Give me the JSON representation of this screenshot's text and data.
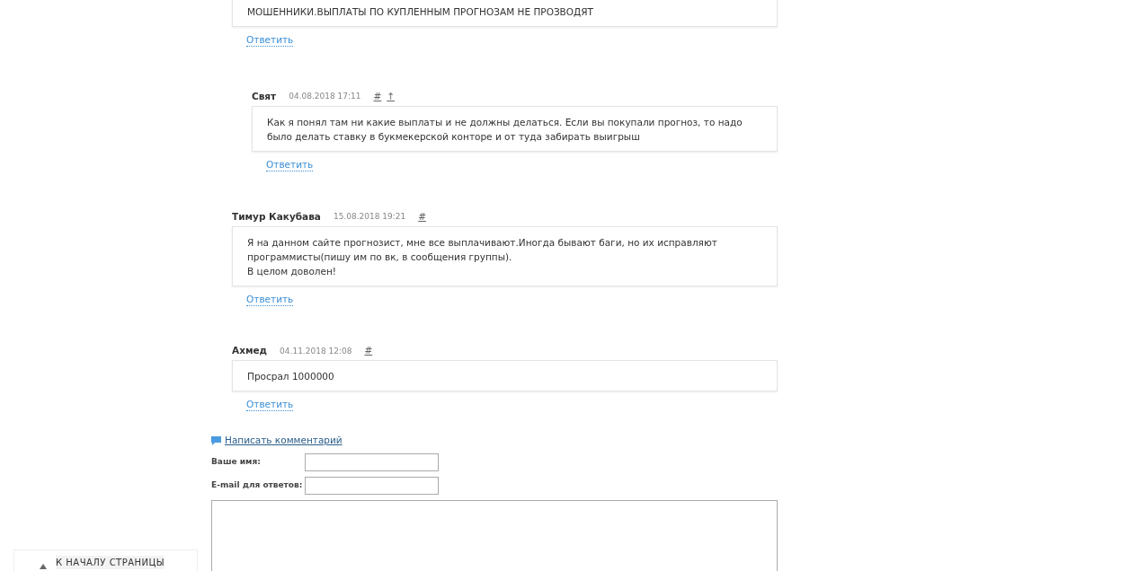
{
  "comments": [
    {
      "lines": [
        "МОШЕННИКИ.ВЫПЛАТЫ ПО КУПЛЕННЫМ ПРОГНОЗАМ НЕ ПРОЗВОДЯТ"
      ],
      "reply": "Ответить",
      "children": [
        {
          "author": "Свят",
          "date": "04.08.2018 17:11",
          "hash": "#",
          "up": "↑",
          "lines": [
            "Как я понял там ни какие выплаты и не должны делаться. Если вы покупали прогноз, то надо было делать ставку в букмекерской конторе и от туда забирать выигрыш"
          ],
          "reply": "Ответить"
        }
      ]
    },
    {
      "author": "Тимур Какубава",
      "date": "15.08.2018 19:21",
      "hash": "#",
      "lines": [
        "Я на данном сайте прогнозист, мне все выплачивают.Иногда бывают баги, но их исправляют программисты(пишу им по вк, в сообщения группы).",
        "В целом доволен!"
      ],
      "reply": "Ответить"
    },
    {
      "author": "Ахмед",
      "date": "04.11.2018 12:08",
      "hash": "#",
      "lines": [
        "Просрал 1000000"
      ],
      "reply": "Ответить"
    }
  ],
  "form": {
    "link": "Написать комментарий",
    "fields": [
      {
        "label": "Ваше имя:",
        "kind": "input"
      },
      {
        "label": "E-mail для ответов:",
        "kind": "input"
      },
      {
        "kind": "textarea"
      }
    ]
  },
  "back_to_top": {
    "label": "К НАЧАЛУ СТРАНИЦЫ"
  }
}
